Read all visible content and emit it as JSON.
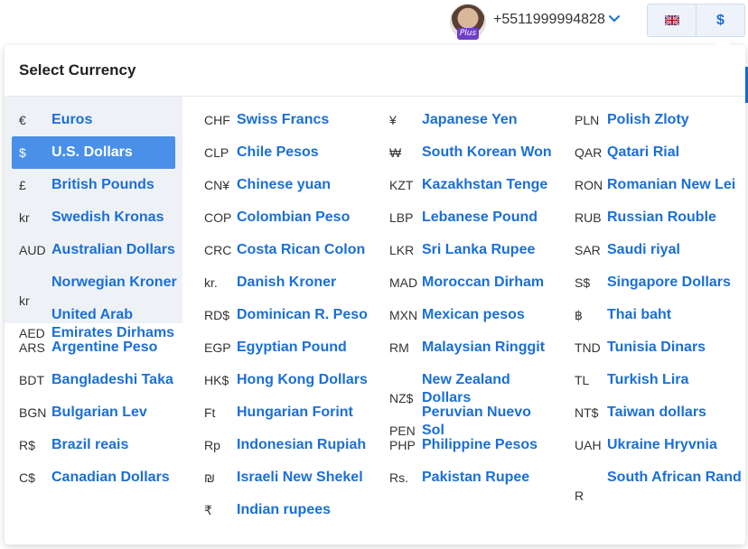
{
  "header": {
    "avatar_badge": "Plus",
    "phone": "+5511999994828",
    "language_flag": "uk-flag-icon",
    "currency_button": "$"
  },
  "panel": {
    "title": "Select Currency",
    "selected": "USD",
    "columns": [
      [
        {
          "code": "EUR",
          "symbol": "€",
          "name": "Euros"
        },
        {
          "code": "USD",
          "symbol": "$",
          "name": "U.S. Dollars"
        },
        {
          "code": "GBP",
          "symbol": "£",
          "name": "British Pounds"
        },
        {
          "code": "SEK",
          "symbol": "kr",
          "name": "Swedish Kronas"
        },
        {
          "code": "AUD",
          "symbol": "AUD",
          "name": "Australian Dollars"
        },
        {
          "code": "NOK",
          "symbol": "kr",
          "name": "Norwegian Kroner"
        },
        {
          "code": "AED",
          "symbol": "AED",
          "name": "United Arab Emirates Dirhams"
        },
        {
          "code": "ARS",
          "symbol": "ARS",
          "name": "Argentine Peso"
        },
        {
          "code": "BDT",
          "symbol": "BDT",
          "name": "Bangladeshi Taka"
        },
        {
          "code": "BGN",
          "symbol": "BGN",
          "name": "Bulgarian Lev"
        },
        {
          "code": "BRL",
          "symbol": "R$",
          "name": "Brazil reais"
        },
        {
          "code": "CAD",
          "symbol": "C$",
          "name": "Canadian Dollars"
        }
      ],
      [
        {
          "code": "CHF",
          "symbol": "CHF",
          "name": "Swiss Francs"
        },
        {
          "code": "CLP",
          "symbol": "CLP",
          "name": "Chile Pesos"
        },
        {
          "code": "CNY",
          "symbol": "CN¥",
          "name": "Chinese yuan"
        },
        {
          "code": "COP",
          "symbol": "COP",
          "name": "Colombian Peso"
        },
        {
          "code": "CRC",
          "symbol": "CRC",
          "name": "Costa Rican Colon"
        },
        {
          "code": "DKK",
          "symbol": "kr.",
          "name": "Danish Kroner"
        },
        {
          "code": "DOP",
          "symbol": "RD$",
          "name": "Dominican R. Peso"
        },
        {
          "code": "EGP",
          "symbol": "EGP",
          "name": "Egyptian Pound"
        },
        {
          "code": "HKD",
          "symbol": "HK$",
          "name": "Hong Kong Dollars"
        },
        {
          "code": "HUF",
          "symbol": "Ft",
          "name": "Hungarian Forint"
        },
        {
          "code": "IDR",
          "symbol": "Rp",
          "name": "Indonesian Rupiah"
        },
        {
          "code": "ILS",
          "symbol": "₪",
          "name": "Israeli New Shekel"
        },
        {
          "code": "INR",
          "symbol": "₹",
          "name": "Indian rupees"
        }
      ],
      [
        {
          "code": "JPY",
          "symbol": "¥",
          "name": "Japanese Yen"
        },
        {
          "code": "KRW",
          "symbol": "₩",
          "name": "South Korean Won"
        },
        {
          "code": "KZT",
          "symbol": "KZT",
          "name": "Kazakhstan Tenge"
        },
        {
          "code": "LBP",
          "symbol": "LBP",
          "name": "Lebanese Pound"
        },
        {
          "code": "LKR",
          "symbol": "LKR",
          "name": "Sri Lanka Rupee"
        },
        {
          "code": "MAD",
          "symbol": "MAD",
          "name": "Moroccan Dirham"
        },
        {
          "code": "MXN",
          "symbol": "MXN",
          "name": "Mexican pesos"
        },
        {
          "code": "MYR",
          "symbol": "RM",
          "name": "Malaysian Ringgit"
        },
        {
          "code": "NZD",
          "symbol": "NZ$",
          "name": "New Zealand Dollars"
        },
        {
          "code": "PEN",
          "symbol": "PEN",
          "name": "Peruvian Nuevo Sol"
        },
        {
          "code": "PHP",
          "symbol": "PHP",
          "name": "Philippine Pesos"
        },
        {
          "code": "PKR",
          "symbol": "Rs.",
          "name": "Pakistan Rupee"
        }
      ],
      [
        {
          "code": "PLN",
          "symbol": "PLN",
          "name": "Polish Zloty"
        },
        {
          "code": "QAR",
          "symbol": "QAR",
          "name": "Qatari Rial"
        },
        {
          "code": "RON",
          "symbol": "RON",
          "name": "Romanian New Lei"
        },
        {
          "code": "RUB",
          "symbol": "RUB",
          "name": "Russian Rouble"
        },
        {
          "code": "SAR",
          "symbol": "SAR",
          "name": "Saudi riyal"
        },
        {
          "code": "SGD",
          "symbol": "S$",
          "name": "Singapore Dollars"
        },
        {
          "code": "THB",
          "symbol": "฿",
          "name": "Thai baht"
        },
        {
          "code": "TND",
          "symbol": "TND",
          "name": "Tunisia Dinars"
        },
        {
          "code": "TRY",
          "symbol": "TL",
          "name": "Turkish Lira"
        },
        {
          "code": "TWD",
          "symbol": "NT$",
          "name": "Taiwan dollars"
        },
        {
          "code": "UAH",
          "symbol": "UAH",
          "name": "Ukraine Hryvnia"
        },
        {
          "code": "ZAR",
          "symbol": "R",
          "name": "South African Rand"
        }
      ]
    ]
  }
}
